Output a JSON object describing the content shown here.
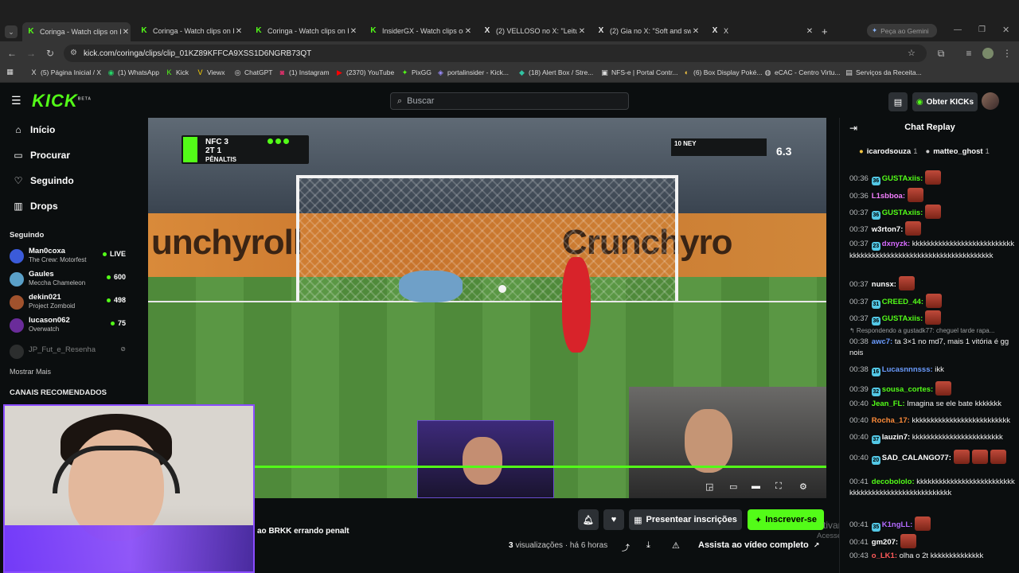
{
  "browser": {
    "tabs": [
      {
        "title": "Coringa - Watch clips on Ki",
        "icon": "kick",
        "active": true
      },
      {
        "title": "Coringa - Watch clips on Ki",
        "icon": "kick"
      },
      {
        "title": "Coringa - Watch clips on Ki",
        "icon": "kick"
      },
      {
        "title": "InsiderGX - Watch clips on",
        "icon": "kick"
      },
      {
        "title": "(2) VELLOSO no X: \"Leitura",
        "icon": "x"
      },
      {
        "title": "(2) Gia no X: \"Soft and swe",
        "icon": "x"
      },
      {
        "title": "X",
        "icon": "x"
      }
    ],
    "new_tab": "+",
    "gemini_label": "Peça ao Gemini",
    "url": "kick.com/coringa/clips/clip_01KZ89KFFCA9XSS1D6NGRB73QT",
    "bookmarks": [
      {
        "label": "(5) Página Inicial / X",
        "icon": "X"
      },
      {
        "label": "(1) WhatsApp",
        "icon": "◉"
      },
      {
        "label": "Kick",
        "icon": "K"
      },
      {
        "label": "Viewx",
        "icon": "V"
      },
      {
        "label": "ChatGPT",
        "icon": "◎"
      },
      {
        "label": "(1) Instagram",
        "icon": "◙"
      },
      {
        "label": "(2370) YouTube",
        "icon": "▶"
      },
      {
        "label": "PixGG",
        "icon": "✦"
      },
      {
        "label": "portalinsider - Kick...",
        "icon": "◈"
      },
      {
        "label": "(18) Alert Box / Stre...",
        "icon": "◆"
      },
      {
        "label": "NFS-e | Portal Contr...",
        "icon": "▣"
      },
      {
        "label": "(6) Box Display Poké...",
        "icon": "◐"
      },
      {
        "label": "eCAC - Centro Virtu...",
        "icon": "◍"
      },
      {
        "label": "Serviços da Receita...",
        "icon": "▤"
      }
    ]
  },
  "kick": {
    "logo": "KICK",
    "logo_sup": "BETA",
    "search_placeholder": "Buscar",
    "obter_label": "Obter KICKs",
    "nav": [
      {
        "label": "Início",
        "icon": "⌂"
      },
      {
        "label": "Procurar",
        "icon": "▭"
      },
      {
        "label": "Seguindo",
        "icon": "♡"
      },
      {
        "label": "Drops",
        "icon": "▥"
      }
    ],
    "following_title": "Seguindo",
    "following": [
      {
        "name": "Man0coxa",
        "game": "The Crew: Motorfest",
        "viewers": "LIVE",
        "color": "#3b5bd9"
      },
      {
        "name": "Gaules",
        "game": "Meccha Chameleon",
        "viewers": "600",
        "color": "#5aa0c8"
      },
      {
        "name": "dekin021",
        "game": "Project Zomboid",
        "viewers": "498",
        "color": "#a0522d"
      },
      {
        "name": "lucason062",
        "game": "Overwatch",
        "viewers": "75",
        "color": "#6a2c9a"
      },
      {
        "name": "JP_Fut_e_Resenha",
        "game": "",
        "viewers": "",
        "color": "#555"
      }
    ],
    "show_more": "Mostrar Mais",
    "recommended_title": "CANAIS RECOMENDADOS"
  },
  "video": {
    "ad_left": "unchyroll",
    "ad_right": "Crunchyro",
    "score_team": "NFC",
    "score_line1": "NFC  3",
    "score_line2": "2T    1",
    "score_phase": "PÊNALTIS",
    "shooter_name": "10 NEY",
    "shooter_rating": "6.3",
    "progress": 1.0
  },
  "clip": {
    "title": "ao BRKK errando penalt",
    "views_count": "3",
    "views_label": "visualizações",
    "age": "· há 6 horas",
    "gift_label": "Presentear inscrições",
    "subscribe_label": "Inscrever-se",
    "full_video_label": "Assista ao vídeo completo"
  },
  "windows_watermark": {
    "line1": "tivar o Windows",
    "line2": "Acesse C                        tivar o Windows."
  },
  "chat": {
    "title": "Chat Replay",
    "pinned": [
      {
        "rank": "1",
        "name": "icarodsouza",
        "count": "1"
      },
      {
        "rank": "2",
        "name": "matteo_ghost",
        "count": "1"
      }
    ],
    "messages": [
      {
        "time": "00:36",
        "user": "GUSTAxiis:",
        "color": "#53fc18",
        "badge": "36",
        "text": "",
        "emote": true
      },
      {
        "time": "00:36",
        "user": "L1sbboa:",
        "color": "#f47fff",
        "badge": "",
        "text": "",
        "emote": true
      },
      {
        "time": "00:37",
        "user": "GUSTAxiis:",
        "color": "#53fc18",
        "badge": "36",
        "text": "",
        "emote": true
      },
      {
        "time": "00:37",
        "user": "w3rton7:",
        "color": "#ffffff",
        "badge": "",
        "text": "",
        "emote": true
      },
      {
        "time": "00:37",
        "user": "dxnyzk:",
        "color": "#d76bff",
        "badge": "23",
        "text": "kkkkkkkkkkkkkkkkkkkkkkkkkkkkkkkkkkkkkkkkkkkkkkkkkkkkkkkkkkkkkkkkk",
        "emote": false
      },
      {
        "time": "00:37",
        "user": "nunsx:",
        "color": "#ffffff",
        "badge": "",
        "text": "",
        "emote": true
      },
      {
        "time": "00:37",
        "user": "CREED_44:",
        "color": "#53fc18",
        "badge": "31",
        "text": "",
        "emote": true
      },
      {
        "time": "00:37",
        "user": "GUSTAxiis:",
        "color": "#53fc18",
        "badge": "36",
        "text": "",
        "emote": true
      },
      {
        "time": "00:38",
        "user": "awc7:",
        "color": "#6b9cff",
        "badge": "",
        "text": "ta 3×1 no md7, mais 1 vitória é gg nois",
        "emote": false
      },
      {
        "time": "00:38",
        "user": "Lucasnnnsss:",
        "color": "#6b9cff",
        "badge": "16",
        "text": "ikk",
        "emote": false
      },
      {
        "time": "00:39",
        "user": "sousa_cortes:",
        "color": "#53fc18",
        "badge": "32",
        "text": "",
        "emote": true
      },
      {
        "time": "00:40",
        "user": "Jean_FL:",
        "color": "#53fc18",
        "badge": "",
        "text": "Imagina se ele bate kkkkkkk",
        "emote": false
      },
      {
        "time": "00:40",
        "user": "Rocha_17:",
        "color": "#ff8c3a",
        "badge": "",
        "text": "kkkkkkkkkkkkkkkkkkkkkkkkkk",
        "emote": false
      },
      {
        "time": "00:40",
        "user": "lauzin7:",
        "color": "#ffffff",
        "badge": "37",
        "text": "kkkkkkkkkkkkkkkkkkkkkkkk",
        "emote": false
      },
      {
        "time": "00:40",
        "user": "SAD_CALANGO77:",
        "color": "#ffffff",
        "badge": "20",
        "text": "",
        "emote": true
      },
      {
        "time": "00:41",
        "user": "decobololo:",
        "color": "#53fc18",
        "badge": "",
        "text": "kkkkkkkkkkkkkkkkkkkkkkkkkkkkkkkkkkkkkkkkkkkkkkkkkkkkk",
        "emote": false
      },
      {
        "time": "00:41",
        "user": "K1ngLL:",
        "color": "#b46bff",
        "badge": "35",
        "text": "",
        "emote": true
      },
      {
        "time": "00:41",
        "user": "gm207:",
        "color": "#ffffff",
        "badge": "",
        "text": "",
        "emote": true
      },
      {
        "time": "00:43",
        "user": "o_LK1:",
        "color": "#ff5a5a",
        "badge": "",
        "text": "olha o 2t kkkkkkkkkkkkkk",
        "emote": false
      }
    ],
    "reply_note": "Respondendo a gustadk77: cheguel tarde rapa..."
  }
}
